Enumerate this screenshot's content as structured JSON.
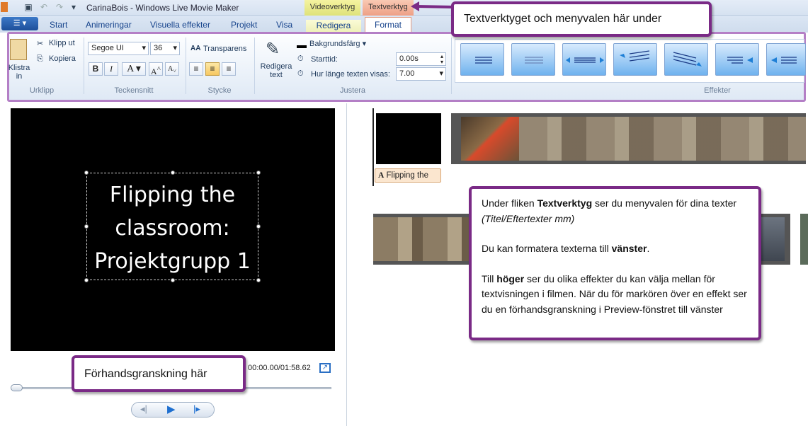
{
  "window": {
    "title": "CarinaBois - Windows Live Movie Maker"
  },
  "contextual_tabs": {
    "video": "Videoverktyg",
    "text": "Textverktyg"
  },
  "tabs": [
    "Start",
    "Animeringar",
    "Visuella effekter",
    "Projekt",
    "Visa",
    "Redigera",
    "Format"
  ],
  "ribbon": {
    "clipboard": {
      "paste": "Klistra in",
      "cut": "Klipp ut",
      "copy": "Kopiera",
      "label": "Urklipp"
    },
    "font": {
      "family": "Segoe UI",
      "size": "36",
      "label": "Teckensnitt",
      "bold": "B",
      "italic": "I",
      "color": "A",
      "grow": "A",
      "shrink": "A",
      "transparency": "Transparens"
    },
    "paragraph": {
      "label": "Stycke"
    },
    "adjust": {
      "edit_text": "Redigera text",
      "background_color": "Bakgrundsfärg",
      "start_time_label": "Starttid:",
      "start_time": "0.00s",
      "duration_label": "Hur länge texten visas:",
      "duration": "7.00",
      "label": "Justera"
    },
    "effects": {
      "label": "Effekter"
    }
  },
  "callouts": {
    "top": "Textverktyget och menyvalen här under",
    "preview": "Förhandsgranskning här",
    "info_line1_pre": "Under fliken ",
    "info_line1_bold": "Textverktyg",
    "info_line1_post": " ser du menyvalen för dina texter ",
    "info_line1_italic": "(Titel/Eftertexter mm)",
    "info_line2_pre": "Du kan formatera texterna till ",
    "info_line2_bold": "vänster",
    "info_line2_post": ".",
    "info_line3_pre": "Till ",
    "info_line3_bold": "höger",
    "info_line3_post": " ser du olika effekter du kan välja mellan för textvisningen i filmen. När du för markören över en effekt ser du en förhandsgranskning i Preview-fönstret till vänster"
  },
  "preview": {
    "text": "Flipping the\nclassroom:\nProjektgrupp 1",
    "timecode": "00:00.00/01:58.62"
  },
  "storyboard": {
    "caption": "Flipping the"
  },
  "colors": {
    "callout_border": "#7a2a86",
    "ribbon_highlight": "#b47fc6"
  }
}
